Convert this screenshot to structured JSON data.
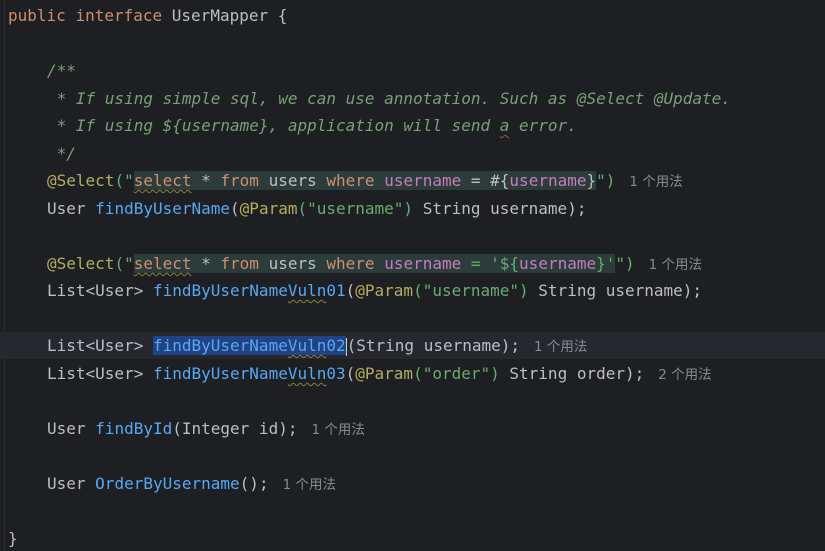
{
  "code": {
    "l1": {
      "kw1": "public",
      "kw2": "interface",
      "name": "UserMapper",
      "brace": "{"
    },
    "c1": "/**",
    "c2a": " * If using simple sql, we can use annotation. Such as @Select @Update.",
    "c3a": " * If using ${username}, application will send ",
    "c3b": "a",
    "c3c": " error.",
    "c4": " */",
    "sel1": {
      "ann": "@Select",
      "open": "(\"",
      "sql_select": "select",
      "sql_star": " * ",
      "sql_from": "from",
      "sql_users": " users ",
      "sql_where": "where",
      "sql_sp": " ",
      "sql_username": "username",
      "sql_eq": " = #{",
      "sql_param": "username",
      "sql_close": "}",
      "close": "\")",
      "hint": "1 个用法"
    },
    "m1": {
      "type": "User ",
      "name": "findByUserName",
      "p_open": "(",
      "p_ann": "@Param",
      "p_str": "(\"username\")",
      "p_rest": " String username);"
    },
    "sel2": {
      "ann": "@Select",
      "open": "(\"",
      "sql_select": "select",
      "sql_star": " * ",
      "sql_from": "from",
      "sql_users": " users ",
      "sql_where": "where",
      "sql_sp": " ",
      "sql_username": "username",
      "sql_eq": " = '${",
      "sql_param": "username",
      "sql_close": "}'",
      "close": "\")",
      "hint": "1 个用法"
    },
    "m2": {
      "type": "List<User> ",
      "name_a": "findByUserName",
      "name_b": "Vuln",
      "name_c": "01",
      "p_open": "(",
      "p_ann": "@Param",
      "p_str": "(\"username\")",
      "p_rest": " String username);"
    },
    "m3": {
      "type": "List<User> ",
      "name_a": "findByUserName",
      "name_b": "Vuln",
      "name_c": "02",
      "rest": "(String username);",
      "hint": "1 个用法"
    },
    "m4": {
      "type": "List<User> ",
      "name_a": "findByUserName",
      "name_b": "Vuln",
      "name_c": "03",
      "p_open": "(",
      "p_ann": "@Param",
      "p_str": "(\"order\")",
      "p_rest": " String order);",
      "hint": "2 个用法"
    },
    "m5": {
      "type": "User ",
      "name": "findById",
      "rest": "(Integer id);",
      "hint": "1 个用法"
    },
    "m6": {
      "type": "User ",
      "name": "OrderByUsername",
      "rest": "();",
      "hint": "1 个用法"
    },
    "end": "}"
  },
  "colors": {
    "background": "#1e1f22",
    "keyword": "#cf8e6d",
    "method": "#56a8f5",
    "annotation": "#b3ae60",
    "string": "#6aab73",
    "comment": "#7a9f7a",
    "selection": "#214283"
  }
}
